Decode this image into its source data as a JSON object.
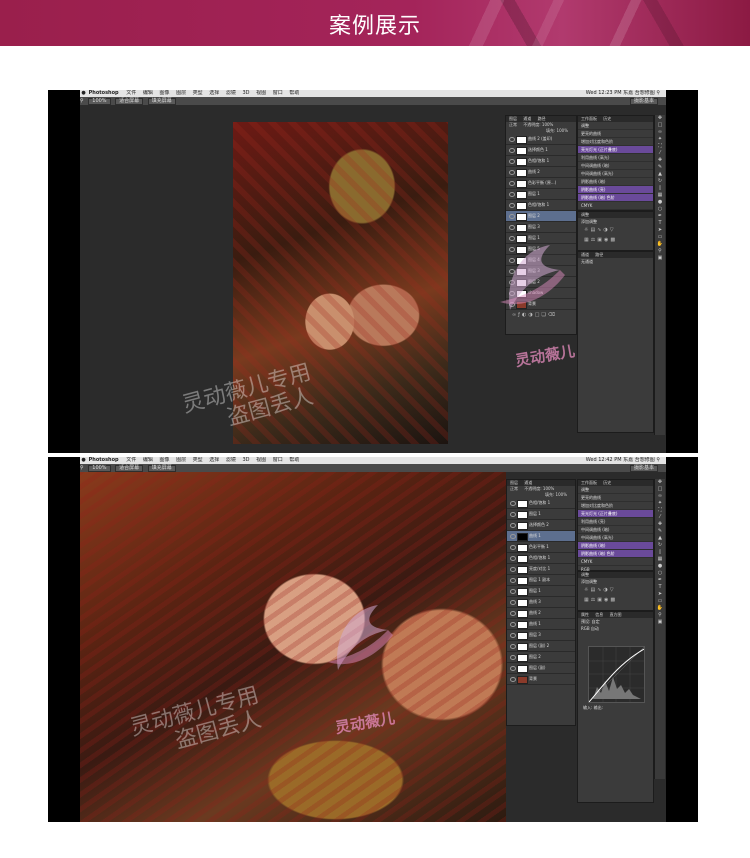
{
  "banner": {
    "title": "案例展示"
  },
  "screens": [
    {
      "menubar": {
        "app": "Photoshop",
        "items": [
          "文件",
          "编辑",
          "图像",
          "图层",
          "类型",
          "选择",
          "滤镜",
          "3D",
          "视图",
          "窗口",
          "帮助"
        ],
        "status": "Wed 12:23 PM",
        "user": "东嘉 吾想修图"
      },
      "optbar": {
        "chips": [
          "100%",
          "适合屏幕",
          "填充屏幕"
        ],
        "workspace": "摄影基本"
      },
      "layers_panel": {
        "tabs": [
          "图层",
          "通道",
          "路径"
        ],
        "blend": "正常",
        "opacity_label": "不透明度: 100%",
        "fill_label": "填充: 100%",
        "rows": [
          {
            "name": "曲线 2 (盖印)"
          },
          {
            "name": "选择颜色 1"
          },
          {
            "name": "色相/饱和 1"
          },
          {
            "name": "曲线 2"
          },
          {
            "name": "色彩平衡 (原...)"
          },
          {
            "name": "图层 1"
          },
          {
            "name": "色相/饱和 1"
          },
          {
            "name": "图层 2",
            "selected": true
          },
          {
            "name": "图层 3"
          },
          {
            "name": "图层 1"
          },
          {
            "name": "图层 5"
          },
          {
            "name": "图层 4"
          },
          {
            "name": "图层 3"
          },
          {
            "name": "图层 2"
          },
          {
            "name": "shadow"
          },
          {
            "name": "背景",
            "photo": true
          }
        ]
      },
      "adjust_panel": {
        "tabs": [
          "工作面板",
          "历史"
        ],
        "rows": [
          {
            "label": "调整"
          },
          {
            "label": "更亮的曲线"
          },
          {
            "label": "增加对比度和色阶"
          },
          {
            "label": "亮光灯光 (正片叠底)",
            "hl": true
          },
          {
            "label": "利用曲线 (高光)"
          },
          {
            "label": "中间调曲线 (暗)"
          },
          {
            "label": "中间调曲线 (高光)"
          },
          {
            "label": "阴影曲线 (暗)"
          },
          {
            "label": "阴影曲线 (亮)",
            "hl": true
          },
          {
            "label": "阴影曲线 (暗) 色阶",
            "hl": true
          },
          {
            "label": "CMYK"
          },
          {
            "label": "RGB"
          },
          {
            "label": "Lab"
          }
        ]
      },
      "props_panel": {
        "tabs": [
          "调整"
        ],
        "title": "添加调整"
      },
      "channels_panel": {
        "tabs": [
          "通道",
          "路径"
        ],
        "label": "无通道"
      }
    },
    {
      "menubar": {
        "app": "Photoshop",
        "items": [
          "文件",
          "编辑",
          "图像",
          "图层",
          "类型",
          "选择",
          "滤镜",
          "3D",
          "视图",
          "窗口",
          "帮助"
        ],
        "status": "Wed 12:42 PM",
        "user": "东嘉 吾想修图"
      },
      "optbar": {
        "chips": [
          "100%",
          "适合屏幕",
          "填充屏幕"
        ],
        "workspace": "摄影基本"
      },
      "layers_panel": {
        "tabs": [
          "图层",
          "通道"
        ],
        "blend": "正常",
        "opacity_label": "不透明度: 100%",
        "fill_label": "填充: 100%",
        "rows": [
          {
            "name": "色相/饱和 1"
          },
          {
            "name": "图层 1"
          },
          {
            "name": "选择颜色 2"
          },
          {
            "name": "曲线 1",
            "selected": true
          },
          {
            "name": "色彩平衡 1"
          },
          {
            "name": "色相/饱和 1"
          },
          {
            "name": "亮度/对比 1"
          },
          {
            "name": "图层 1 副本"
          },
          {
            "name": "图层 1"
          },
          {
            "name": "曲线 3"
          },
          {
            "name": "曲线 2"
          },
          {
            "name": "曲线 1"
          },
          {
            "name": "图层 3"
          },
          {
            "name": "图层 (副) 2"
          },
          {
            "name": "图层 2"
          },
          {
            "name": "图层 (副)"
          },
          {
            "name": "背景",
            "photo": true
          }
        ]
      },
      "adjust_panel": {
        "tabs": [
          "工作面板",
          "历史"
        ],
        "rows": [
          {
            "label": "调整"
          },
          {
            "label": "更亮的曲线"
          },
          {
            "label": "增加对比度和色阶"
          },
          {
            "label": "亮光灯光 (正片叠底)",
            "hl": true
          },
          {
            "label": "利用曲线 (亮)"
          },
          {
            "label": "中间调曲线 (暗)"
          },
          {
            "label": "中间调曲线 (高光)"
          },
          {
            "label": "阴影曲线 (暗)",
            "hl": true
          },
          {
            "label": "阴影曲线 (暗) 色阶",
            "hl": true
          },
          {
            "label": "CMYK"
          },
          {
            "label": "RGB"
          },
          {
            "label": "Lab"
          }
        ]
      },
      "props_panel": {
        "tabs": [
          "调整"
        ],
        "title": "添加调整"
      },
      "curves_panel": {
        "tabs": [
          "属性",
          "信息",
          "直方图"
        ],
        "preset_label": "预设:",
        "preset": "自定",
        "channel": "RGB",
        "auto_button": "自动",
        "input_label": "输入:",
        "output_label": "输出:"
      }
    }
  ],
  "watermark": {
    "line1": "灵动薇儿专用",
    "line2": "盗图丢人",
    "logo_text": "灵动薇儿"
  }
}
